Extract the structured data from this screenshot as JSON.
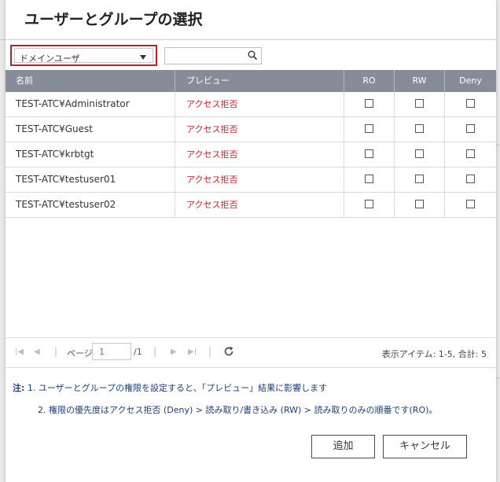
{
  "dialog": {
    "title": "ユーザーとグループの選択"
  },
  "filter": {
    "selected": "ドメインユーザ",
    "search_placeholder": ""
  },
  "table": {
    "headers": {
      "name": "名前",
      "preview": "プレビュー",
      "ro": "RO",
      "rw": "RW",
      "deny": "Deny"
    },
    "rows": [
      {
        "name": "TEST-ATC¥Administrator",
        "preview": "アクセス拒否"
      },
      {
        "name": "TEST-ATC¥Guest",
        "preview": "アクセス拒否"
      },
      {
        "name": "TEST-ATC¥krbtgt",
        "preview": "アクセス拒否"
      },
      {
        "name": "TEST-ATC¥testuser01",
        "preview": "アクセス拒否"
      },
      {
        "name": "TEST-ATC¥testuser02",
        "preview": "アクセス拒否"
      }
    ]
  },
  "pager": {
    "page_label": "ページ",
    "page_value": "1",
    "page_total": "/1",
    "item_info": "表示アイテム: 1-5, 合計: 5"
  },
  "notes": {
    "label": "注:",
    "note1": "1. ユーザーとグループの権限を設定すると、「プレビュー」結果に影響します",
    "note2": "2. 権限の優先度はアクセス拒否 (Deny) > 読み取り/書き込み (RW) > 読み取りのみの順番です(RO)。"
  },
  "buttons": {
    "add": "追加",
    "cancel": "キャンセル"
  },
  "colors": {
    "header_bg": "#868d99",
    "deny_text": "#c0282f",
    "highlight_border": "#b8202a"
  }
}
